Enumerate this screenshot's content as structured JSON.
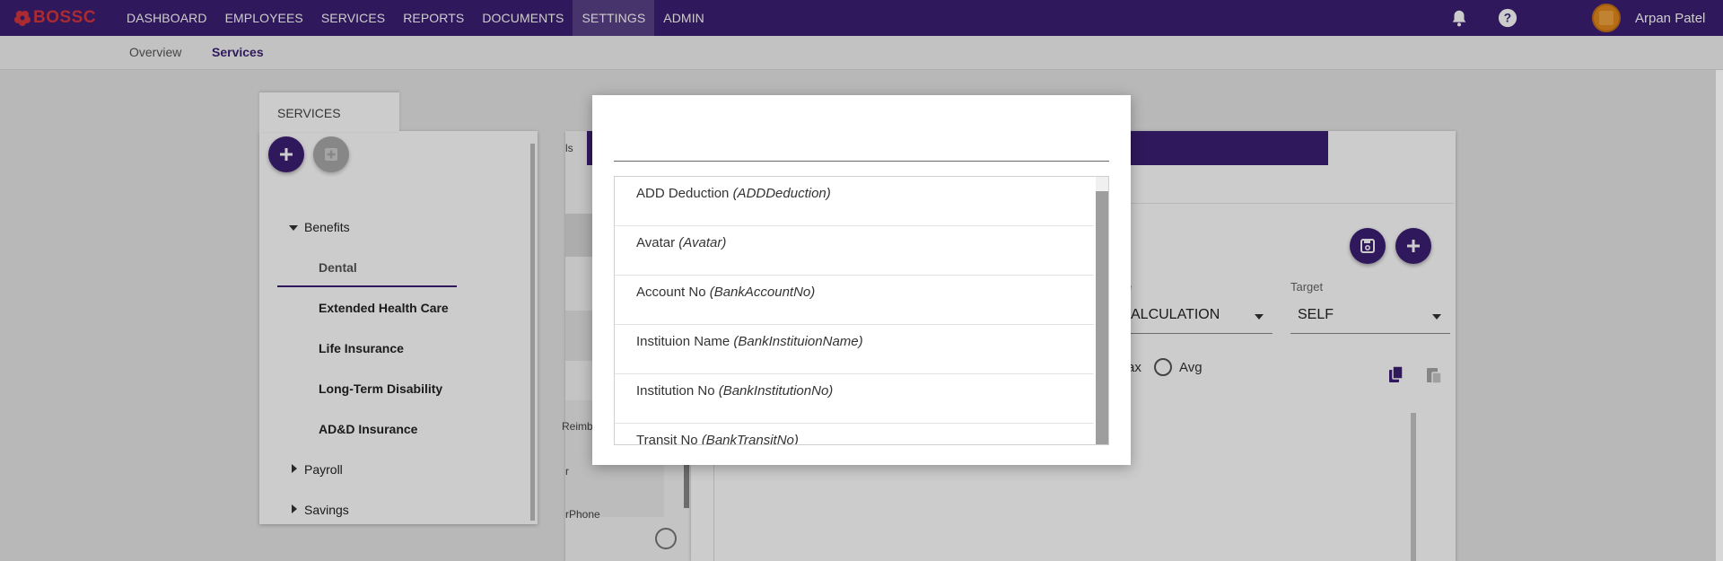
{
  "brand": {
    "name": "BOSSC",
    "logo_color": "#d6363f",
    "bar_color": "#3d1f73"
  },
  "nav": {
    "items": [
      {
        "label": "DASHBOARD"
      },
      {
        "label": "EMPLOYEES"
      },
      {
        "label": "SERVICES"
      },
      {
        "label": "REPORTS"
      },
      {
        "label": "DOCUMENTS"
      },
      {
        "label": "SETTINGS",
        "active": true
      },
      {
        "label": "ADMIN"
      }
    ]
  },
  "top_right": {
    "icons": [
      "bell-icon",
      "help-icon"
    ],
    "user_name": "Arpan Patel"
  },
  "subnav": {
    "items": [
      {
        "label": "Overview"
      },
      {
        "label": "Services",
        "active": true
      }
    ]
  },
  "services_panel": {
    "tab_label": "SERVICES",
    "buttons": [
      "add-icon",
      "add-child-icon"
    ],
    "tree": {
      "group": "Benefits",
      "children": [
        "Dental",
        "Extended Health Care",
        "Life Insurance",
        "Long-Term Disability",
        "AD&D Insurance"
      ],
      "selected": "Dental",
      "collapsed_groups": [
        "Payroll",
        "Savings"
      ]
    }
  },
  "middle_panel": {
    "texts": [
      "ls",
      "Reimb",
      "r",
      "rPhone"
    ]
  },
  "editor": {
    "calc_value": "ALCULATION",
    "calc_label_fragment": "e",
    "target_label": "Target",
    "target_value": "SELF",
    "radio_fragment": "ax",
    "radio_avg": "Avg",
    "icons": [
      "save-icon",
      "add-icon",
      "copy-icon",
      "paste-icon"
    ]
  },
  "modal": {
    "search": {
      "value": "",
      "placeholder": ""
    },
    "items": [
      {
        "label": "ADD Deduction",
        "code": "(ADDDeduction)"
      },
      {
        "label": "Avatar",
        "code": "(Avatar)"
      },
      {
        "label": "Account No",
        "code": "(BankAccountNo)"
      },
      {
        "label": "Instituion Name",
        "code": "(BankInstituionName)"
      },
      {
        "label": "Institution No",
        "code": "(BankInstitutionNo)"
      },
      {
        "label": "Transit No",
        "code": "(BankTransitNo)"
      }
    ]
  }
}
